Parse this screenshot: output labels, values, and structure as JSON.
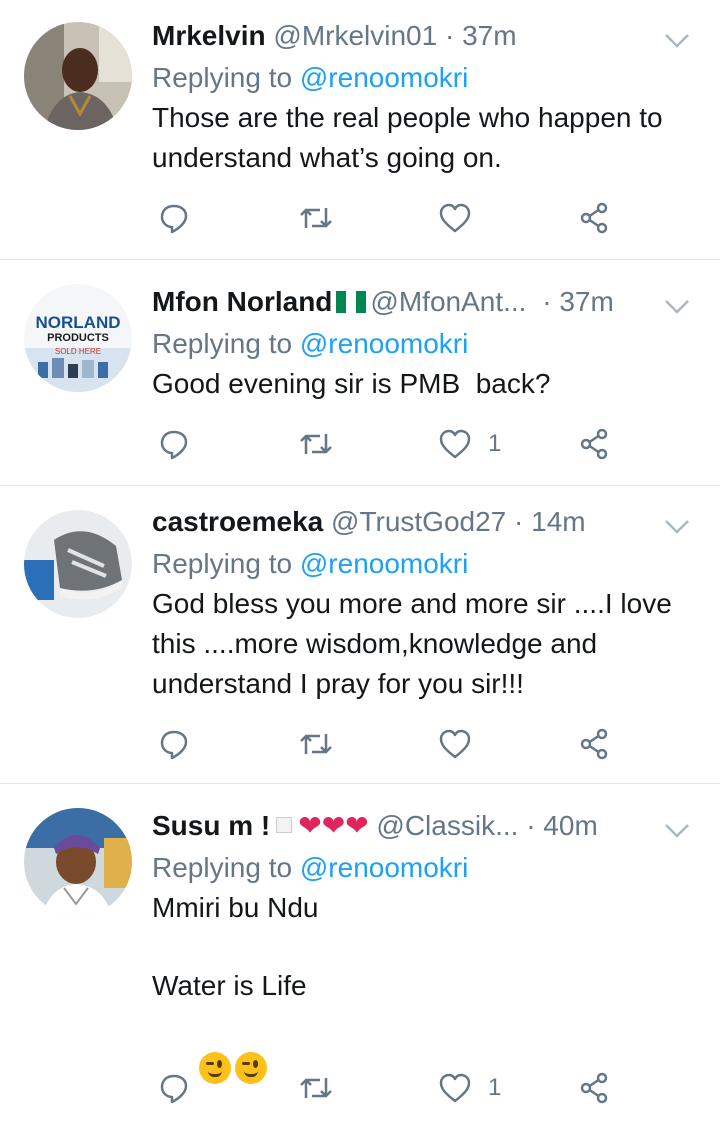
{
  "colors": {
    "accent": "#1da1f2",
    "muted": "#657786",
    "text": "#14171a",
    "divider": "#e1e8ed"
  },
  "tweets": [
    {
      "name": "Mrkelvin",
      "handle": "@Mrkelvin01",
      "sep": "·",
      "time": "37m",
      "replying_prefix": "Replying to",
      "replying_to": "@renoomokri",
      "text": "Those are the real people who happen to\nunderstand what’s going on.",
      "actions": {
        "reply_count": "",
        "retweet_count": "",
        "like_count": ""
      }
    },
    {
      "name": "Mfon Norland",
      "handle": "@MfonAnt...",
      "sep": "·",
      "time": "37m",
      "replying_prefix": "Replying to",
      "replying_to": "@renoomokri",
      "text": "Good evening sir is PMB  back?",
      "avatar_logo": {
        "line1": "NORLAND",
        "line2": "PRODUCTS",
        "line3": "SOLD HERE"
      },
      "actions": {
        "reply_count": "",
        "retweet_count": "",
        "like_count": "1"
      }
    },
    {
      "name": "castroemeka",
      "handle": "@TrustGod27",
      "sep": "·",
      "time": "14m",
      "replying_prefix": "Replying to",
      "replying_to": "@renoomokri",
      "text": "God bless you more and more sir ....I love\nthis ....more wisdom,knowledge and\nunderstand I pray for you sir!!!",
      "actions": {
        "reply_count": "",
        "retweet_count": "",
        "like_count": ""
      }
    },
    {
      "name": "Susu m !",
      "hearts": "❤❤❤",
      "handle": "@Classik...",
      "sep": "·",
      "time": "40m",
      "replying_prefix": "Replying to",
      "replying_to": "@renoomokri",
      "text_line1": "Mmiri bu Ndu",
      "text_line2": "Water is Life",
      "actions": {
        "reply_count": "",
        "retweet_count": "",
        "like_count": "1"
      }
    }
  ],
  "icons": [
    "reply-icon",
    "retweet-icon",
    "like-icon",
    "share-icon",
    "chevron-down-icon"
  ]
}
